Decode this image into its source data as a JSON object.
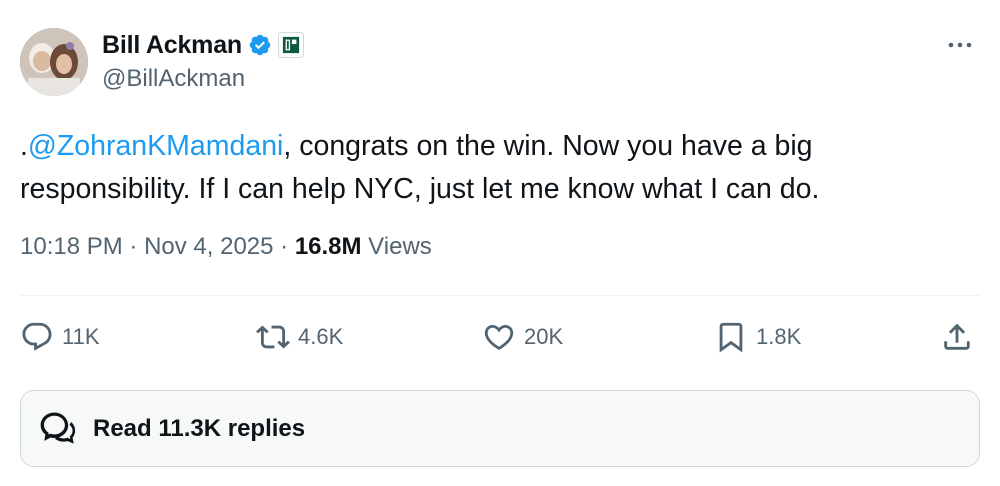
{
  "author": {
    "display_name": "Bill Ackman",
    "handle": "@BillAckman",
    "verified": true,
    "avatar": "profile-photo",
    "affiliation_badge": "affiliate-logo-icon"
  },
  "tweet": {
    "prefix": ".",
    "mention": "@ZohranKMamdani",
    "body": ", congrats on the win. Now you have a big responsibility. If I can help NYC, just let me know what I can do."
  },
  "meta": {
    "time": "10:18 PM",
    "separator": " · ",
    "date": "Nov 4, 2025",
    "views_count": "16.8M",
    "views_label": " Views"
  },
  "actions": {
    "replies": "11K",
    "reposts": "4.6K",
    "likes": "20K",
    "bookmarks": "1.8K"
  },
  "replies_button": {
    "label": "Read 11.3K replies"
  },
  "colors": {
    "accent": "#1d9bf0",
    "text": "#0f1419",
    "secondary": "#536471",
    "border": "#cfd9de"
  },
  "icons": [
    "more-icon",
    "verified-badge-icon",
    "reply-icon",
    "repost-icon",
    "like-icon",
    "bookmark-icon",
    "share-icon",
    "replies-bubble-icon"
  ]
}
